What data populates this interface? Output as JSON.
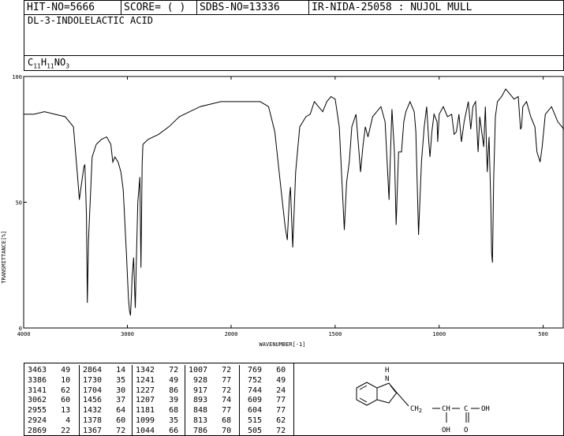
{
  "header": {
    "hit_no": "HIT-NO=5666",
    "score": "SCORE=  (   )",
    "sdbs_no": "SDBS-NO=13336",
    "ir_code": "IR-NIDA-25058 : NUJOL MULL"
  },
  "compound": {
    "name": "DL-3-INDOLELACTIC ACID",
    "formula": "C11H11NO3"
  },
  "chart_data": {
    "type": "line",
    "xlabel": "WAVENUMBER[-1]",
    "ylabel": "TRANSMITTANCE[%]",
    "xlim": [
      4000,
      400
    ],
    "ylim": [
      0,
      100
    ],
    "xticks": [
      "4000",
      "3000",
      "2000",
      "1500",
      "1000",
      "500"
    ],
    "yticks": [
      "100",
      "50",
      "0"
    ],
    "series": [
      {
        "points": [
          [
            4000,
            85
          ],
          [
            3900,
            85
          ],
          [
            3800,
            86
          ],
          [
            3700,
            85
          ],
          [
            3600,
            84
          ],
          [
            3520,
            80
          ],
          [
            3480,
            60
          ],
          [
            3463,
            51
          ],
          [
            3450,
            55
          ],
          [
            3420,
            64
          ],
          [
            3410,
            65
          ],
          [
            3395,
            45
          ],
          [
            3386,
            10
          ],
          [
            3375,
            35
          ],
          [
            3340,
            68
          ],
          [
            3300,
            73
          ],
          [
            3250,
            75
          ],
          [
            3200,
            76
          ],
          [
            3160,
            73
          ],
          [
            3141,
            66
          ],
          [
            3120,
            68
          ],
          [
            3090,
            66
          ],
          [
            3062,
            62
          ],
          [
            3040,
            55
          ],
          [
            3010,
            30
          ],
          [
            2990,
            12
          ],
          [
            2980,
            7
          ],
          [
            2970,
            5
          ],
          [
            2960,
            14
          ],
          [
            2955,
            20
          ],
          [
            2940,
            28
          ],
          [
            2932,
            18
          ],
          [
            2924,
            8
          ],
          [
            2916,
            22
          ],
          [
            2900,
            50
          ],
          [
            2880,
            60
          ],
          [
            2869,
            24
          ],
          [
            2858,
            65
          ],
          [
            2850,
            73
          ],
          [
            2800,
            75
          ],
          [
            2700,
            77
          ],
          [
            2600,
            80
          ],
          [
            2500,
            84
          ],
          [
            2400,
            86
          ],
          [
            2300,
            88
          ],
          [
            2200,
            89
          ],
          [
            2100,
            90
          ],
          [
            2000,
            90
          ],
          [
            1900,
            90
          ],
          [
            1860,
            90
          ],
          [
            1820,
            88
          ],
          [
            1790,
            78
          ],
          [
            1760,
            55
          ],
          [
            1740,
            40
          ],
          [
            1730,
            35
          ],
          [
            1720,
            52
          ],
          [
            1715,
            56
          ],
          [
            1704,
            32
          ],
          [
            1690,
            62
          ],
          [
            1670,
            80
          ],
          [
            1640,
            84
          ],
          [
            1620,
            85
          ],
          [
            1600,
            90
          ],
          [
            1580,
            88
          ],
          [
            1560,
            86
          ],
          [
            1540,
            90
          ],
          [
            1520,
            92
          ],
          [
            1500,
            91
          ],
          [
            1480,
            80
          ],
          [
            1456,
            39
          ],
          [
            1445,
            58
          ],
          [
            1432,
            66
          ],
          [
            1420,
            80
          ],
          [
            1400,
            85
          ],
          [
            1378,
            62
          ],
          [
            1367,
            72
          ],
          [
            1355,
            80
          ],
          [
            1342,
            76
          ],
          [
            1320,
            84
          ],
          [
            1300,
            86
          ],
          [
            1280,
            88
          ],
          [
            1260,
            82
          ],
          [
            1241,
            51
          ],
          [
            1230,
            80
          ],
          [
            1227,
            87
          ],
          [
            1215,
            70
          ],
          [
            1207,
            41
          ],
          [
            1195,
            70
          ],
          [
            1181,
            70
          ],
          [
            1170,
            82
          ],
          [
            1160,
            86
          ],
          [
            1140,
            90
          ],
          [
            1120,
            86
          ],
          [
            1112,
            78
          ],
          [
            1099,
            37
          ],
          [
            1085,
            66
          ],
          [
            1072,
            80
          ],
          [
            1060,
            88
          ],
          [
            1050,
            74
          ],
          [
            1044,
            68
          ],
          [
            1035,
            78
          ],
          [
            1025,
            85
          ],
          [
            1010,
            82
          ],
          [
            1007,
            74
          ],
          [
            1000,
            85
          ],
          [
            980,
            88
          ],
          [
            960,
            84
          ],
          [
            940,
            85
          ],
          [
            928,
            77
          ],
          [
            917,
            78
          ],
          [
            905,
            85
          ],
          [
            893,
            74
          ],
          [
            880,
            82
          ],
          [
            860,
            90
          ],
          [
            848,
            79
          ],
          [
            838,
            88
          ],
          [
            825,
            90
          ],
          [
            813,
            70
          ],
          [
            805,
            84
          ],
          [
            786,
            72
          ],
          [
            778,
            88
          ],
          [
            769,
            62
          ],
          [
            760,
            76
          ],
          [
            752,
            50
          ],
          [
            748,
            30
          ],
          [
            744,
            26
          ],
          [
            738,
            60
          ],
          [
            730,
            84
          ],
          [
            720,
            90
          ],
          [
            700,
            92
          ],
          [
            680,
            95
          ],
          [
            660,
            93
          ],
          [
            640,
            91
          ],
          [
            620,
            92
          ],
          [
            609,
            79
          ],
          [
            604,
            80
          ],
          [
            598,
            88
          ],
          [
            580,
            90
          ],
          [
            560,
            84
          ],
          [
            540,
            80
          ],
          [
            530,
            70
          ],
          [
            515,
            66
          ],
          [
            505,
            72
          ],
          [
            490,
            85
          ],
          [
            460,
            88
          ],
          [
            430,
            82
          ],
          [
            400,
            79
          ]
        ]
      }
    ]
  },
  "peaks": {
    "columns": [
      [
        [
          "3463",
          "49"
        ],
        [
          "3386",
          "10"
        ],
        [
          "3141",
          "62"
        ],
        [
          "3062",
          "60"
        ],
        [
          "2955",
          "13"
        ],
        [
          "2924",
          "4"
        ],
        [
          "2869",
          "22"
        ]
      ],
      [
        [
          "2864",
          "14"
        ],
        [
          "1730",
          "35"
        ],
        [
          "1704",
          "30"
        ],
        [
          "1456",
          "37"
        ],
        [
          "1432",
          "64"
        ],
        [
          "1378",
          "60"
        ],
        [
          "1367",
          "72"
        ]
      ],
      [
        [
          "1342",
          "72"
        ],
        [
          "1241",
          "49"
        ],
        [
          "1227",
          "86"
        ],
        [
          "1207",
          "39"
        ],
        [
          "1181",
          "68"
        ],
        [
          "1099",
          "35"
        ],
        [
          "1044",
          "66"
        ]
      ],
      [
        [
          "1007",
          "72"
        ],
        [
          "928",
          "77"
        ],
        [
          "917",
          "72"
        ],
        [
          "893",
          "74"
        ],
        [
          "848",
          "77"
        ],
        [
          "813",
          "68"
        ],
        [
          "786",
          "70"
        ]
      ],
      [
        [
          "769",
          "60"
        ],
        [
          "752",
          "49"
        ],
        [
          "744",
          "24"
        ],
        [
          "609",
          "77"
        ],
        [
          "604",
          "77"
        ],
        [
          "515",
          "62"
        ],
        [
          "505",
          "72"
        ]
      ]
    ]
  },
  "structure": {
    "nh": "H\nN",
    "chain": "CH2–CH–C–OH",
    "oh": "OH",
    "o": "O"
  }
}
